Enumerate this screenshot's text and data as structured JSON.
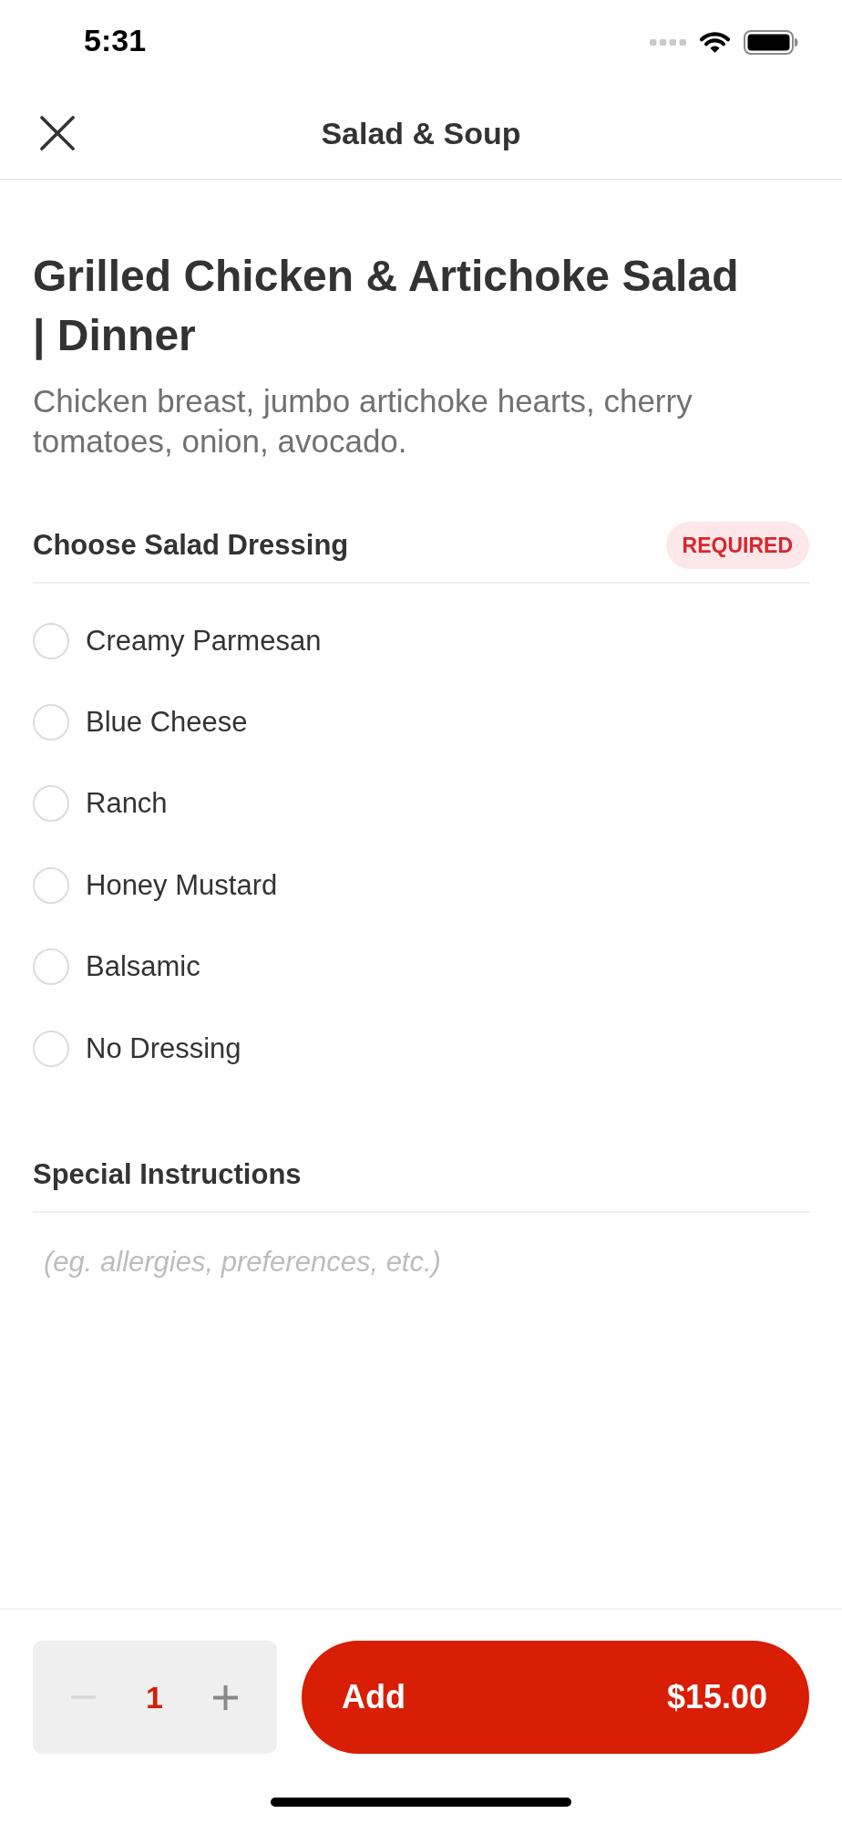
{
  "status_bar": {
    "time": "5:31"
  },
  "nav": {
    "title": "Salad & Soup"
  },
  "item": {
    "title": "Grilled Chicken & Artichoke Salad | Dinner",
    "description": "Chicken breast, jumbo artichoke hearts, cherry tomatoes, onion, avocado."
  },
  "dressing": {
    "title": "Choose Salad Dressing",
    "badge": "REQUIRED",
    "options": [
      {
        "label": "Creamy Parmesan",
        "selected": false
      },
      {
        "label": "Blue Cheese",
        "selected": false
      },
      {
        "label": "Ranch",
        "selected": false
      },
      {
        "label": "Honey Mustard",
        "selected": false
      },
      {
        "label": "Balsamic",
        "selected": false
      },
      {
        "label": "No Dressing",
        "selected": false
      }
    ]
  },
  "special_instructions": {
    "title": "Special Instructions",
    "placeholder": "(eg. allergies, preferences, etc.)"
  },
  "footer": {
    "quantity": {
      "value": "1",
      "decrement": {
        "disabled": true
      },
      "increment": {
        "disabled": false
      }
    },
    "add_button": {
      "label": "Add",
      "price": "$15.00"
    }
  }
}
